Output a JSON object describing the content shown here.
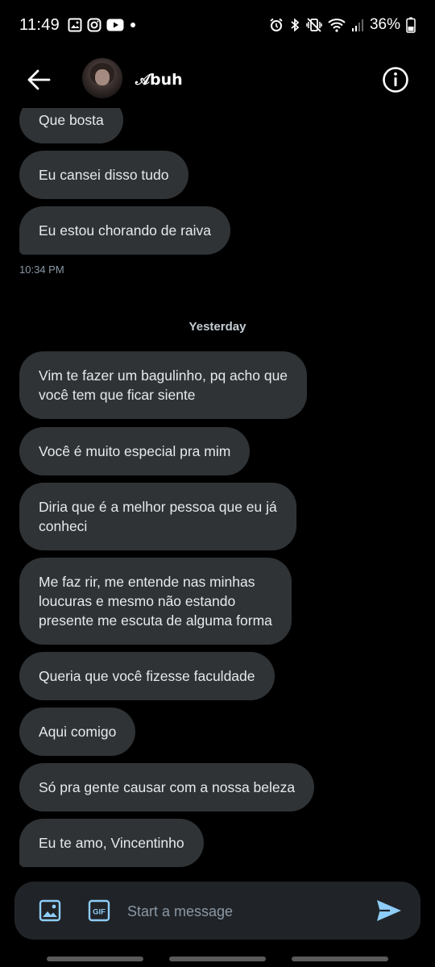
{
  "status_bar": {
    "time": "11:49",
    "battery": "36%",
    "left_icons": [
      "gallery-icon",
      "instagram-icon",
      "youtube-icon",
      "dot-icon"
    ],
    "right_icons": [
      "alarm-icon",
      "bluetooth-icon",
      "vibrate-icon",
      "wifi-icon",
      "signal-icon",
      "battery-icon"
    ]
  },
  "header": {
    "contact_name": "𝒜buh"
  },
  "conversation": {
    "earlier": [
      {
        "text": "Que bosta"
      },
      {
        "text": "Eu cansei disso tudo"
      },
      {
        "text": "Eu estou chorando de raiva"
      }
    ],
    "earlier_timestamp": "10:34 PM",
    "day_divider": "Yesterday",
    "recent": [
      {
        "text": "Vim te fazer um bagulinho, pq acho que\nvocê tem que ficar siente"
      },
      {
        "text": "Você é muito especial pra mim"
      },
      {
        "text": "Diria que é a melhor pessoa que eu já\nconheci"
      },
      {
        "text": "Me faz rir, me entende nas minhas\nloucuras e mesmo não estando\npresente me escuta de alguma forma"
      },
      {
        "text": "Queria que você fizesse faculdade"
      },
      {
        "text": "Aqui comigo"
      },
      {
        "text": "Só pra gente causar com a nossa beleza"
      },
      {
        "text": "Eu te amo, Vincentinho"
      }
    ]
  },
  "composer": {
    "placeholder": "Start a message",
    "gif_label": "GIF"
  },
  "colors": {
    "background": "#000000",
    "bubble": "#2f3336",
    "composer": "#202327",
    "text": "#e7e9ea",
    "muted": "#8b98a5",
    "send": "#8ecdf8"
  }
}
